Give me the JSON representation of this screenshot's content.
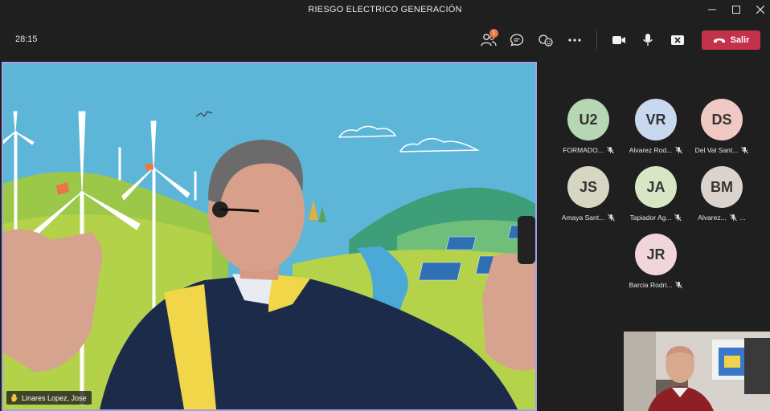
{
  "window": {
    "title": "RIESGO ELECTRICO GENERACIÓN"
  },
  "toolbar": {
    "timer": "28:15",
    "participants_badge": "1",
    "leave_label": "Salir"
  },
  "main_video": {
    "speaker_name": "Linares Lopez, Jose"
  },
  "participants": [
    {
      "initials": "U2",
      "name": "FORMADO...",
      "color": "#b5d7b3"
    },
    {
      "initials": "VR",
      "name": "Alvarez Rod...",
      "color": "#c7d8ef"
    },
    {
      "initials": "DS",
      "name": "Del Val Sant...",
      "color": "#f1c9c4"
    },
    {
      "initials": "JS",
      "name": "Amaya Sant...",
      "color": "#d6d6c2"
    },
    {
      "initials": "JA",
      "name": "Tapiador Ag...",
      "color": "#d8e6c6"
    },
    {
      "initials": "BM",
      "name": "Alvarez...",
      "color": "#dcd3cd",
      "more": "..."
    },
    {
      "initials": "JR",
      "name": "Barcia Rodri...",
      "color": "#f0d6d8"
    }
  ]
}
